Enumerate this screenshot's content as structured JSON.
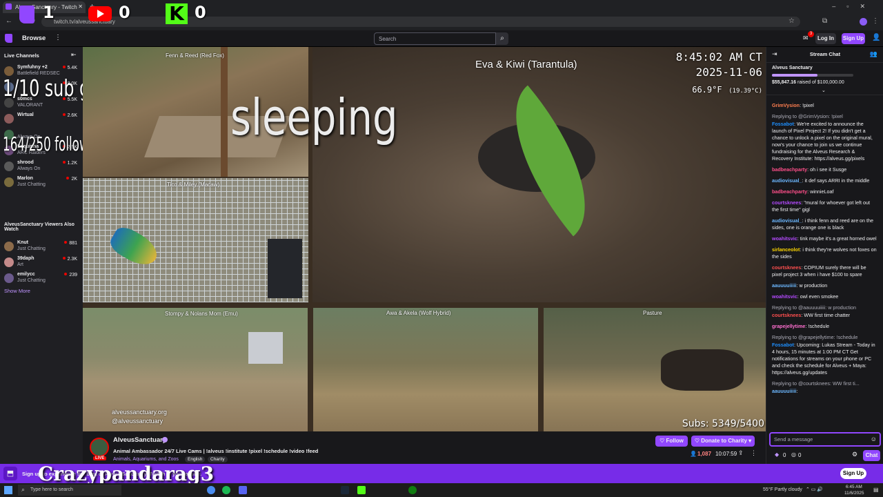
{
  "browser": {
    "tab_title": "AlveusSanctuary - Twitch",
    "url": "twitch.tv/alveussanctuary"
  },
  "overlay": {
    "twitch_count": "1",
    "youtube_count": "0",
    "kick_count": "0",
    "sub_goal": "1/10 sub goal",
    "follower_goal": "164/250 follower goal",
    "status_text": "sleeping",
    "watermark_name": "Crazypandarag3",
    "subs_counter": "Subs: 5349/5400"
  },
  "topnav": {
    "browse_label": "Browse",
    "search_placeholder": "Search",
    "notif_badge": "3",
    "login_label": "Log In",
    "signup_label": "Sign Up"
  },
  "sidebar": {
    "live_channels_heading": "Live Channels",
    "channels": [
      {
        "name": "Symfuhny +2",
        "game": "Battlefield REDSEC",
        "viewers": "5.4K",
        "color": "#7a5c3a"
      },
      {
        "name": "",
        "game": "",
        "viewers": "8.0K",
        "color": "#5b6b8c"
      },
      {
        "name": "s0mcs",
        "game": "VALORANT",
        "viewers": "5.5K",
        "color": "#444"
      },
      {
        "name": "Wirtual",
        "game": "",
        "viewers": "2.6K",
        "color": "#8c5b5b"
      },
      {
        "name": "",
        "game": "Always On",
        "viewers": "",
        "color": "#3d6b4a"
      },
      {
        "name": "Sequisha",
        "game": "ARC Raiders",
        "viewers": "2.5K",
        "color": "#6b4a7a"
      },
      {
        "name": "shrood",
        "game": "Always On",
        "viewers": "1.2K",
        "color": "#5a5a5a"
      },
      {
        "name": "Marlon",
        "game": "Just Chatting",
        "viewers": "2K",
        "color": "#7a6b3d"
      }
    ],
    "also_watch_heading": "AlveusSanctuary Viewers Also Watch",
    "also_watch": [
      {
        "name": "Knut",
        "game": "Just Chatting",
        "viewers": "881",
        "color": "#8c6b4a"
      },
      {
        "name": "39daph",
        "game": "Art",
        "viewers": "2.3K",
        "color": "#c48a8a"
      },
      {
        "name": "emilycc",
        "game": "Just Chatting",
        "viewers": "239",
        "color": "#6b5a8c"
      }
    ],
    "show_more_label": "Show More"
  },
  "video": {
    "cam_labels": {
      "fox": "Fenn & Reed (Red Fox)",
      "tarantula": "Eva & Kiwi (Tarantula)",
      "macaw": "Tico & Miley (Macaw)",
      "emu": "Stompy & Nolans Mom (Emu)",
      "wolf": "Awa & Akela (Wolf Hybrid)",
      "pasture": "Pasture"
    },
    "clock_time": "8:45:02 AM CT",
    "clock_date": "2025-11-06",
    "temp_f": "66.9°F",
    "temp_c": "(19.39°C)",
    "site_url": "alveussanctuary.org",
    "social_handle": "@alveussanctuary"
  },
  "stream_info": {
    "channel_name": "AlveusSanctuary",
    "title": "Animal Ambassador 24/7 Live Cams | !alveus !institute !pixel !schedule !video !feed",
    "category": "Animals, Aquariums, and Zoos",
    "tags": [
      "English",
      "Charity"
    ],
    "live_badge": "LIVE",
    "follow_label": "Follow",
    "donate_label": "Donate to Charity",
    "viewer_count": "1,087",
    "uptime": "10:07:59"
  },
  "chat": {
    "header": "Stream Chat",
    "charity_name": "Alveus Sanctuary",
    "raised_amount": "$55,847.16",
    "raised_text": "raised of $100,000.00",
    "charity_progress": 0.558,
    "messages": [
      {
        "user": "GrimVysion",
        "color": "#ff7f50",
        "text": "!pixel"
      },
      {
        "reply": "Replying to @GrimVysion: !pixel",
        "user": "Fossabot",
        "color": "#1e90ff",
        "text": "We're excited to announce the launch of Pixel Project 2! If you didn't get a chance to unlock a pixel on the original mural, now's your chance to join us we continue fundraising for the Alveus Research & Recovery Institute: https://alveus.gg/pixels"
      },
      {
        "user": "badbeachparty",
        "color": "#ff4f8a",
        "text": "oh i see it Susge"
      },
      {
        "user": "audiovisual_",
        "color": "#6cb7ff",
        "text": "it def says ARRI in the middle"
      },
      {
        "user": "badbeachparty",
        "color": "#ff4f8a",
        "text": "winnieLoaf"
      },
      {
        "user": "courtsknees",
        "color": "#b44aff",
        "text": "\"mural for whoever got left out the first time\" gigl"
      },
      {
        "user": "audiovisual_",
        "color": "#6cb7ff",
        "text": "i think fenn and reed are on the sides, one is orange one is black"
      },
      {
        "user": "woahitsvic",
        "color": "#b44aff",
        "text": "tink maybe it's a great horned owel"
      },
      {
        "user": "sirlanceolot",
        "color": "#ffd700",
        "text": "i think they're wolves not foxes on the sides"
      },
      {
        "user": "courtsknees",
        "color": "#ff4f4f",
        "text": "COPIUM surely there will be pixel project 3 when i have $100 to spare"
      },
      {
        "user": "aauuuuiiiii",
        "color": "#6cb7ff",
        "text": "w production"
      },
      {
        "user": "woahitsvic",
        "color": "#b44aff",
        "text": "owl even smokee"
      },
      {
        "reply": "Replying to @aauuuuiiiii: w production",
        "user": "courtsknees",
        "color": "#ff4f4f",
        "text": "WW first time chatter"
      },
      {
        "user": "grapejellytime",
        "color": "#ff6fcf",
        "text": "!schedule"
      },
      {
        "reply": "Replying to @grapejellytime: !schedule",
        "user": "Fossabot",
        "color": "#1e90ff",
        "text": "Upcoming: Lukas Stream - Today in 4 hours, 15 minutes at 1:00 PM CT Get notifications for streams on your phone or PC and check the schedule for Alveus + Maya: https://alveus.gg/updates"
      },
      {
        "reply": "Replying to @courtsknees: WW first ti...",
        "user": "aauuuuiiiii",
        "color": "#6cb7ff",
        "text": ""
      }
    ],
    "input_placeholder": "Send a message",
    "points_a": "0",
    "points_b": "0",
    "chat_button": "Chat"
  },
  "banner": {
    "text": "Sign up to experience the best of AlveusSanctuary. Twitch is your oyster.",
    "signup_label": "Sign Up"
  },
  "taskbar": {
    "search_placeholder": "Type here to search",
    "weather": "55°F  Partly cloudy",
    "time": "6:45 AM",
    "date": "11/6/2025"
  },
  "colors": {
    "twitch_purple": "#9147ff",
    "banner_purple": "#772ce8",
    "live_red": "#eb0400",
    "kick_green": "#53fc18",
    "youtube_red": "#ff0000"
  }
}
